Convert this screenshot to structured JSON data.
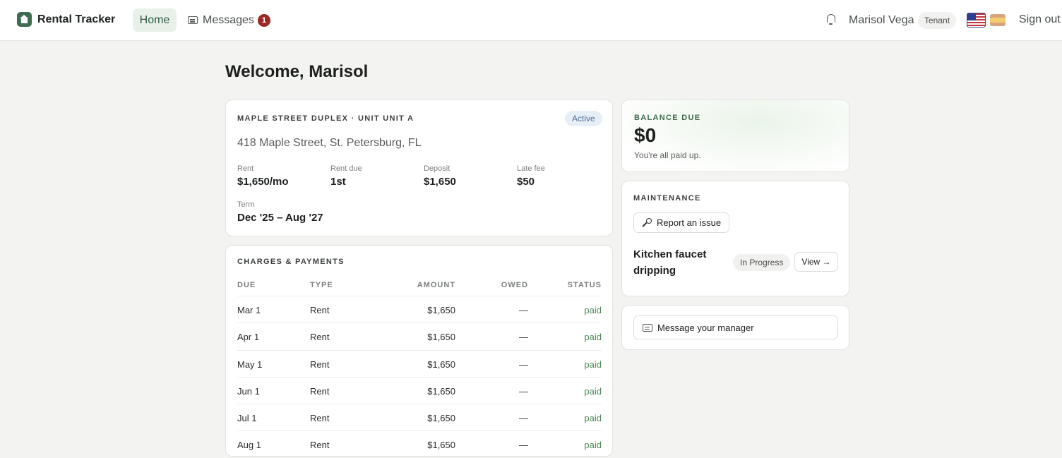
{
  "app": {
    "name": "Rental Tracker"
  },
  "nav": {
    "home": "Home",
    "messages": "Messages",
    "messages_badge": "1"
  },
  "user": {
    "name": "Marisol Vega",
    "role": "Tenant",
    "sign_out": "Sign out",
    "languages": [
      "us-flag",
      "es-flag"
    ]
  },
  "page": {
    "welcome": "Welcome, Marisol"
  },
  "property": {
    "label": "MAPLE STREET DUPLEX · UNIT UNIT A",
    "status": "Active",
    "address": "418 Maple Street, St. Petersburg, FL",
    "rent_label": "Rent",
    "rent": "$1,650/mo",
    "rent_due_label": "Rent due",
    "rent_due": "1st",
    "deposit_label": "Deposit",
    "deposit": "$1,650",
    "late_fee_label": "Late fee",
    "late_fee": "$50",
    "term_label": "Term",
    "term": "Dec '25 – Aug '27"
  },
  "charges": {
    "label": "CHARGES & PAYMENTS",
    "headers": {
      "due": "DUE",
      "type": "TYPE",
      "amount": "AMOUNT",
      "owed": "OWED",
      "status": "STATUS"
    },
    "rows": [
      {
        "due": "Mar 1",
        "type": "Rent",
        "amount": "$1,650",
        "owed": "—",
        "status": "paid"
      },
      {
        "due": "Apr 1",
        "type": "Rent",
        "amount": "$1,650",
        "owed": "—",
        "status": "paid"
      },
      {
        "due": "May 1",
        "type": "Rent",
        "amount": "$1,650",
        "owed": "—",
        "status": "paid"
      },
      {
        "due": "Jun 1",
        "type": "Rent",
        "amount": "$1,650",
        "owed": "—",
        "status": "paid"
      },
      {
        "due": "Jul 1",
        "type": "Rent",
        "amount": "$1,650",
        "owed": "—",
        "status": "paid"
      },
      {
        "due": "Aug 1",
        "type": "Rent",
        "amount": "$1,650",
        "owed": "—",
        "status": "paid"
      }
    ]
  },
  "balance": {
    "label": "BALANCE DUE",
    "amount": "$0",
    "note": "You're all paid up."
  },
  "maintenance": {
    "label": "MAINTENANCE",
    "report_button": "Report an issue",
    "issue_title": "Kitchen faucet dripping",
    "issue_status": "In Progress",
    "view_button": "View →"
  },
  "message": {
    "button": "Message your manager"
  },
  "colors": {
    "brand": "#3f6d4f",
    "badge": "#9b2a26",
    "paid": "#4b8a55",
    "active_pill": "#e8eef6"
  }
}
